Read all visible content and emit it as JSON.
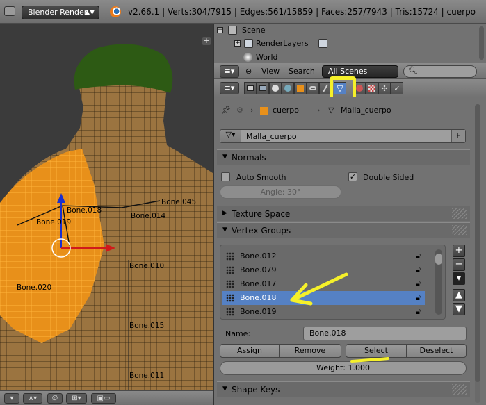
{
  "header": {
    "render_engine": "Blender Render",
    "stats": "v2.66.1 | Verts:304/7915 | Edges:561/15859 | Faces:257/7943 | Tris:15724 | cuerpo"
  },
  "viewport": {
    "bone_labels": [
      "Bone.018",
      "Bone.019",
      "Bone.045",
      "Bone.014",
      "Bone.010",
      "Bone.020",
      "Bone.015",
      "Bone.011"
    ],
    "add_region": "+"
  },
  "outliner": {
    "items": [
      "Scene",
      "RenderLayers",
      "World"
    ],
    "view_menu": "View",
    "search_menu": "Search",
    "scenes_select": "All Scenes"
  },
  "properties": {
    "breadcrumb": {
      "object": "cuerpo",
      "mesh": "Malla_cuerpo"
    },
    "mesh_name": "Malla_cuerpo",
    "fake_user": "F",
    "normals": {
      "title": "Normals",
      "auto_smooth": "Auto Smooth",
      "double_sided": "Double Sided",
      "angle": "Angle: 30°"
    },
    "texture_space": "Texture Space",
    "vertex_groups": {
      "title": "Vertex Groups",
      "items": [
        "Bone.012",
        "Bone.079",
        "Bone.017",
        "Bone.018",
        "Bone.019"
      ],
      "selected": "Bone.018",
      "name_label": "Name:",
      "name_value": "Bone.018",
      "assign": "Assign",
      "remove": "Remove",
      "select": "Select",
      "deselect": "Deselect",
      "weight": "Weight: 1.000"
    },
    "shape_keys": "Shape Keys"
  },
  "colors": {
    "highlight": "#f5f02a",
    "selected_row": "#5581c4",
    "mesh_orange": "#e8901a",
    "beret_green": "#2d5a14"
  }
}
